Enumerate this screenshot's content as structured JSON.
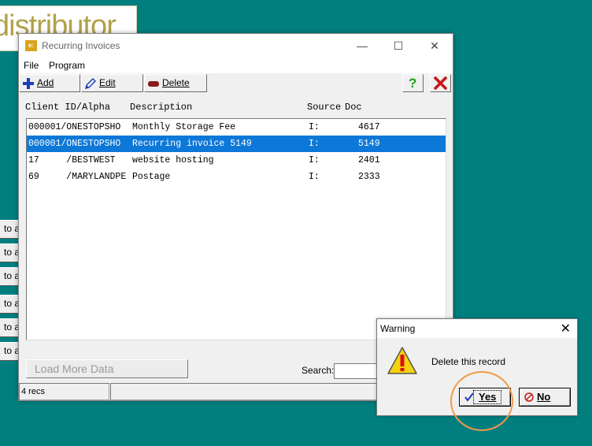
{
  "background": {
    "logo_text": "distributor",
    "side_buttons": [
      "to a",
      "to a",
      "to a",
      "to a",
      "to a",
      "to a"
    ]
  },
  "window": {
    "app_icon_text": "e:",
    "title": "Recurring Invoices",
    "controls": {
      "minimize": "—",
      "maximize": "☐",
      "close": "✕"
    }
  },
  "menu": {
    "file": "File",
    "program": "Program"
  },
  "toolbar": {
    "add_label": "Add",
    "edit_label": "Edit",
    "delete_label": "Delete",
    "help_label": "?"
  },
  "columns": {
    "client": "Client ID/Alpha",
    "description": "Description",
    "source": "Source",
    "doc": "Doc"
  },
  "rows": [
    {
      "id": "000001/ONESTOPSHO",
      "description": "Monthly Storage Fee",
      "source": "I:",
      "doc": "4617",
      "selected": false
    },
    {
      "id": "000001/ONESTOPSHO",
      "description": "Recurring invoice 5149",
      "source": "I:",
      "doc": "5149",
      "selected": true
    },
    {
      "id": "17     /BESTWEST",
      "description": "website hosting",
      "source": "I:",
      "doc": "2401",
      "selected": false
    },
    {
      "id": "69     /MARYLANDPE",
      "description": "Postage",
      "source": "I:",
      "doc": "2333",
      "selected": false
    }
  ],
  "footer": {
    "load_more": "Load More Data",
    "search_label": "Search:",
    "search_value": ""
  },
  "status": {
    "count": "4 recs"
  },
  "dialog": {
    "title": "Warning",
    "close": "✕",
    "message": "Delete this record",
    "yes_label": "Yes",
    "no_label": "No"
  },
  "colors": {
    "selection": "#0d78d7",
    "desktop": "#017f7f",
    "highlight": "#f29a4a"
  }
}
